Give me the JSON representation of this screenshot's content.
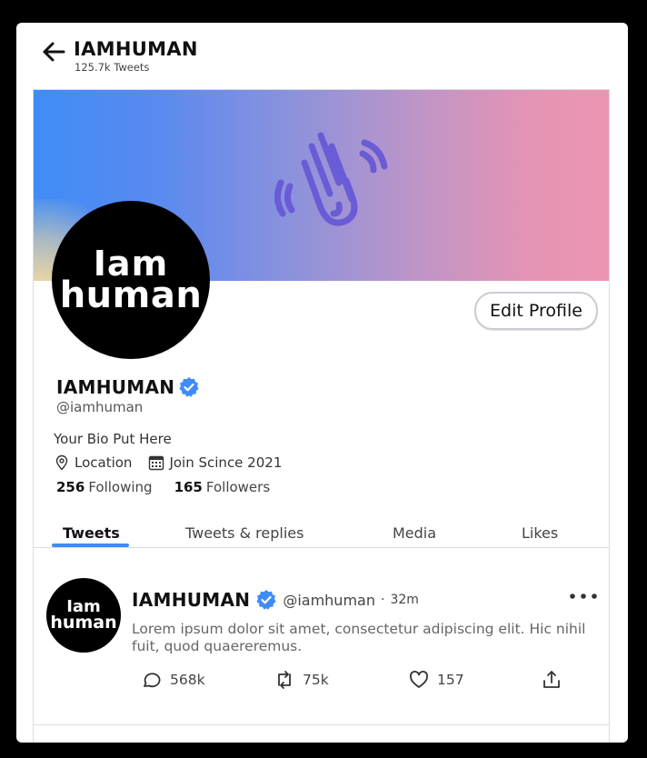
{
  "header": {
    "title": "IAMHUMAN",
    "subtitle": "125.7k Tweets"
  },
  "profile": {
    "avatar_line1": "Iam",
    "avatar_line2": "human",
    "edit_label": "Edit Profile",
    "name": "IAMHUMAN",
    "handle": "@iamhuman",
    "bio": "Your Bio Put Here",
    "location": "Location",
    "joined": "Join Scince 2021",
    "following_count": "256",
    "following_label": "Following",
    "followers_count": "165",
    "followers_label": "Followers"
  },
  "tabs": [
    "Tweets",
    "Tweets & replies",
    "Media",
    "Likes"
  ],
  "tweet": {
    "name": "IAMHUMAN",
    "handle": "@iamhuman",
    "separator": "·",
    "time": "32m",
    "text": "Lorem ipsum dolor sit amet, consectetur adipiscing elit. Hic nihil fuit, quod quaereremus.",
    "replies": "568k",
    "retweets": "75k",
    "likes": "157"
  },
  "colors": {
    "accent": "#3f8cf6",
    "verified": "#3f8cf6",
    "logo_purple": "#6a5bd6"
  }
}
